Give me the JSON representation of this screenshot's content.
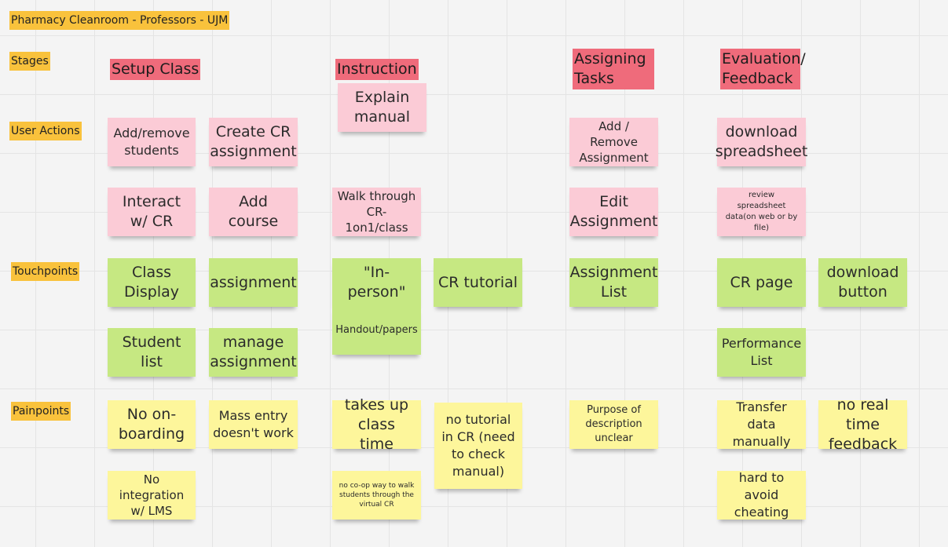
{
  "board": {
    "title": "Pharmacy Cleanroom - Professors - UJM"
  },
  "row_labels": {
    "stages": "Stages",
    "user_actions": "User Actions",
    "touchpoints": "Touchpoints",
    "painpoints": "Painpoints"
  },
  "stages": {
    "setup": "Setup Class",
    "instruction": "Instruction",
    "assigning": "Assigning Tasks",
    "evaluation": "Evaluation/ Feedback"
  },
  "user_actions": {
    "add_remove_students": "Add/remove students",
    "create_cr_assignment": "Create CR assignment",
    "explain_manual": "Explain manual",
    "add_remove_assignment": "Add / Remove Assignment",
    "download_spreadsheet": "download spreadsheet",
    "interact_cr": "Interact w/ CR",
    "add_course": "Add course",
    "walk_through": "Walk through CR-1on1/class",
    "edit_assignment": "Edit Assignment",
    "review_spreadsheet": "review spreadsheet data(on web or by file)"
  },
  "touchpoints": {
    "class_display": "Class Display",
    "assignment": "assignment",
    "in_person": "\"In-person\"",
    "cr_tutorial": "CR tutorial",
    "assignment_list": "Assignment List",
    "cr_page": "CR page",
    "download_button": "download button",
    "student_list": "Student list",
    "manage_assignment": "manage assignment",
    "handout_papers": "Handout/papers",
    "performance_list": "Performance List"
  },
  "painpoints": {
    "no_onboarding": "No on-boarding",
    "mass_entry": "Mass entry doesn't work",
    "takes_class_time": "takes up class time",
    "no_tutorial": "no tutorial in CR (need to check manual)",
    "purpose_unclear": "Purpose of description unclear",
    "transfer_data": "Transfer data manually",
    "no_realtime": "no real time feedback",
    "no_integration": "No integration w/ LMS",
    "no_coop": "no co-op way to walk students through the virtual CR",
    "hard_cheating": "hard to avoid cheating"
  }
}
